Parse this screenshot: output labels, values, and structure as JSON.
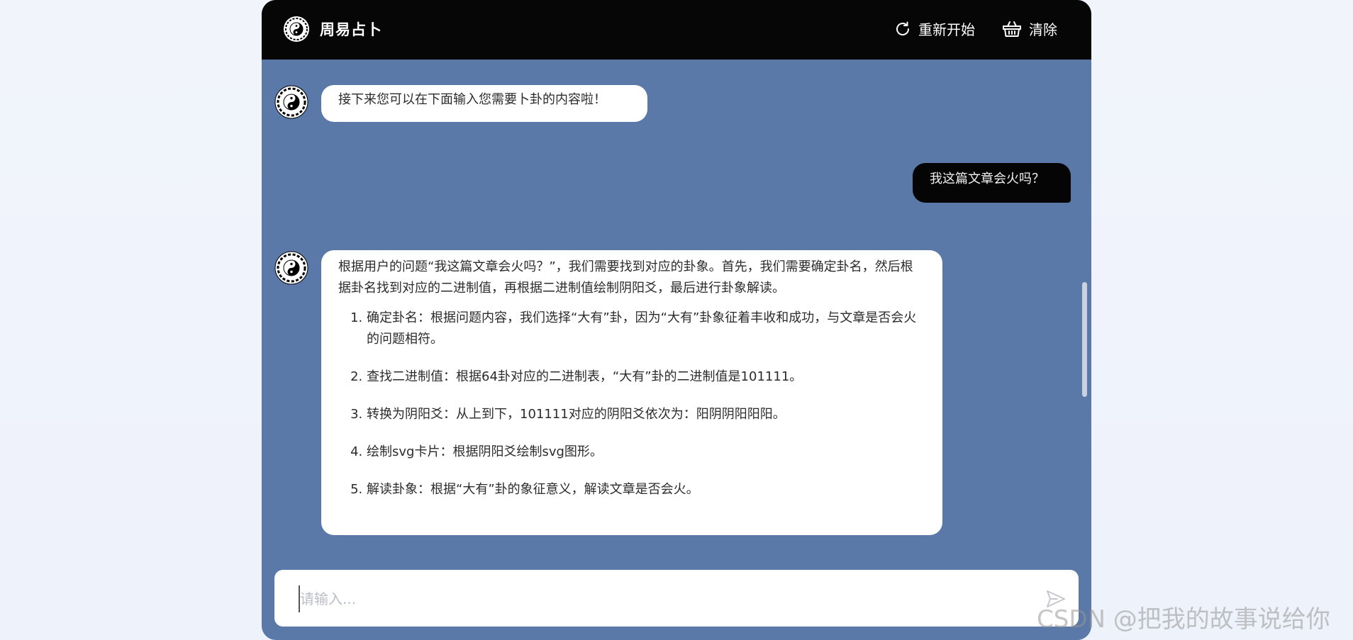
{
  "header": {
    "title": "周易占卜",
    "restart_label": "重新开始",
    "clear_label": "清除",
    "logo_icon": "yin-yang-bagua-icon",
    "restart_icon": "refresh-icon",
    "clear_icon": "basket-icon"
  },
  "messages": [
    {
      "role": "assistant",
      "text": "接下来您可以在下面输入您需要卜卦的内容啦！"
    },
    {
      "role": "user",
      "text": "我这篇文章会火吗？"
    },
    {
      "role": "assistant",
      "intro": "根据用户的问题“我这篇文章会火吗？”，我们需要找到对应的卦象。首先，我们需要确定卦名，然后根据卦名找到对应的二进制值，再根据二进制值绘制阴阳爻，最后进行卦象解读。",
      "steps": [
        "确定卦名：根据问题内容，我们选择“大有”卦，因为“大有”卦象征着丰收和成功，与文章是否会火的问题相符。",
        "查找二进制值：根据64卦对应的二进制表，“大有”卦的二进制值是101111。",
        "转换为阴阳爻：从上到下，101111对应的阴阳爻依次为：阳阴阴阳阳阳。",
        "绘制svg卡片：根据阴阳爻绘制svg图形。",
        "解读卦象：根据“大有”卦的象征意义，解读文章是否会火。"
      ]
    }
  ],
  "composer": {
    "placeholder": "请输入...",
    "value": "",
    "send_icon": "send-icon"
  },
  "watermark": "CSDN @把我的故事说给你",
  "colors": {
    "page_background": "#eef2fb",
    "chat_background": "#5a79a8",
    "header_background": "#060606",
    "user_bubble": "#050505",
    "assistant_bubble": "#ffffff"
  }
}
